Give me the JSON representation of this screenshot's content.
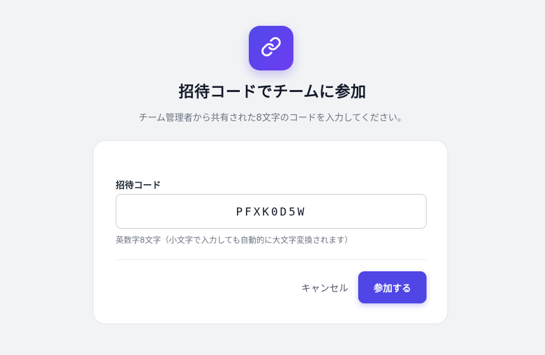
{
  "header": {
    "icon": "link-icon",
    "title": "招待コードでチームに参加",
    "subtitle": "チーム管理者から共有された8文字のコードを入力してください。"
  },
  "form": {
    "code_label": "招待コード",
    "code_value": "PFXK0D5W",
    "code_hint": "英数字8文字（小文字で入力しても自動的に大文字変換されます）"
  },
  "actions": {
    "cancel_label": "キャンセル",
    "join_label": "参加する"
  },
  "colors": {
    "accent": "#4f46e5",
    "background": "#f2f3f5"
  }
}
